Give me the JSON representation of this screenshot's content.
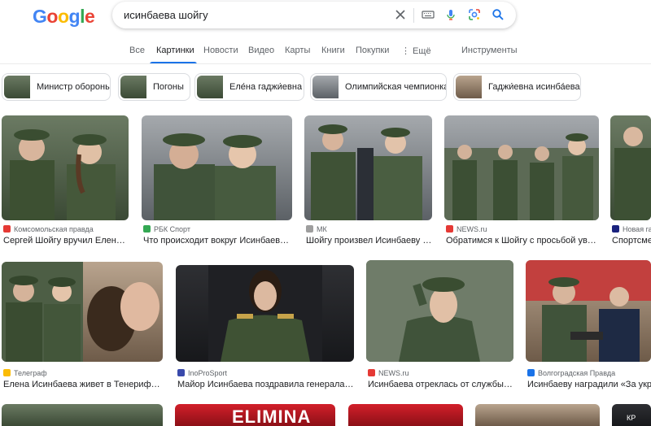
{
  "search": {
    "query": "исинбаева шойгу"
  },
  "tabs": [
    "Все",
    "Картинки",
    "Новости",
    "Видео",
    "Карты",
    "Книги",
    "Покупки",
    "⋮ Ещё",
    "Инструменты"
  ],
  "chips": [
    {
      "label": "Министр обороны"
    },
    {
      "label": "Погоны"
    },
    {
      "label": "Еле́на гаджи́евна"
    },
    {
      "label": "Олимпийская чемпионка"
    },
    {
      "label": "Гаджи́евна исинба́ева"
    }
  ],
  "row1": [
    {
      "source": "Комсомольская правда",
      "title": "Сергей Шойгу вручил Елене ..."
    },
    {
      "source": "РБК Спорт",
      "title": "Что происходит вокруг Исинбаевой ..."
    },
    {
      "source": "МК",
      "title": "Шойгу произвел Исинбаеву в ..."
    },
    {
      "source": "NEWS.ru",
      "title": "Обратимся к Шойгу с просьбой уво..."
    },
    {
      "source": "Новая газ",
      "title": "Спортсме"
    }
  ],
  "row2": [
    {
      "source": "Телеграф",
      "title": "Елена Исинбаева живет в Тенерифе -..."
    },
    {
      "source": "InoProSport",
      "title": "Майор Исинбаева поздравила генерала ..."
    },
    {
      "source": "NEWS.ru",
      "title": "Исинбаева отреклась от службы в..."
    },
    {
      "source": "Волгоградская Правда",
      "title": "Исинбаеву наградили «За укреп"
    }
  ],
  "row3_text": {
    "elimina": "ELIMINA",
    "kr": "КР"
  },
  "colors": {
    "accent": "#1a73e8",
    "google_blue": "#4285f4",
    "google_red": "#ea4335",
    "google_yellow": "#fbbc05",
    "google_green": "#34a853"
  }
}
